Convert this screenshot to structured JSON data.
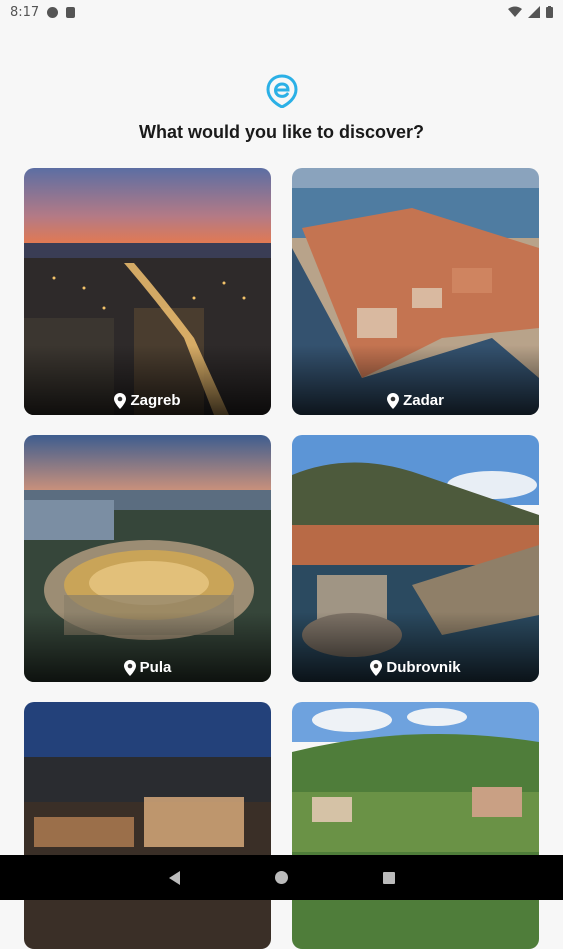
{
  "status_bar": {
    "time": "8:17"
  },
  "header": {
    "title": "What would you like to discover?"
  },
  "destinations": [
    {
      "name": "Zagreb"
    },
    {
      "name": "Zadar"
    },
    {
      "name": "Pula"
    },
    {
      "name": "Dubrovnik"
    },
    {
      "name": ""
    },
    {
      "name": ""
    }
  ],
  "colors": {
    "brand": "#2bb0e6"
  },
  "icons": [
    "wifi-icon",
    "signal-icon",
    "battery-icon",
    "location-pin-icon",
    "back-icon",
    "home-icon",
    "recents-icon"
  ]
}
